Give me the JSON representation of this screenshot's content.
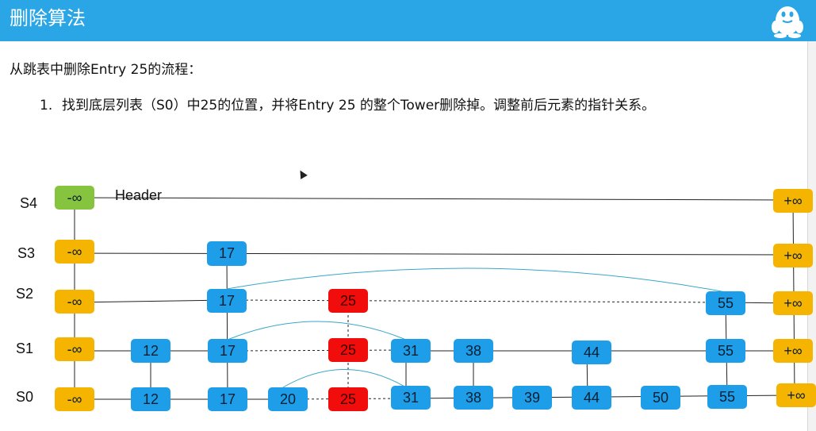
{
  "slide": {
    "title": "删除算法",
    "intro": "从跳表中删除Entry 25的流程：",
    "step_number": "1.",
    "step_text": "找到底层列表（S0）中25的位置，并将Entry 25 的整个Tower删除掉。调整前后元素的指针关系。"
  },
  "diagram": {
    "header_label": "Header",
    "levels": [
      "S4",
      "S3",
      "S2",
      "S1",
      "S0"
    ],
    "nodes": {
      "s4_neg": "-∞",
      "s4_pos": "+∞",
      "s3_neg": "-∞",
      "s3_17": "17",
      "s3_pos": "+∞",
      "s2_neg": "-∞",
      "s2_17": "17",
      "s2_25": "25",
      "s2_55": "55",
      "s2_pos": "+∞",
      "s1_neg": "-∞",
      "s1_12": "12",
      "s1_17": "17",
      "s1_25": "25",
      "s1_31": "31",
      "s1_38": "38",
      "s1_44": "44",
      "s1_55": "55",
      "s1_pos": "+∞",
      "s0_neg": "-∞",
      "s0_12": "12",
      "s0_17": "17",
      "s0_20": "20",
      "s0_25": "25",
      "s0_31": "31",
      "s0_38": "38",
      "s0_39": "39",
      "s0_44": "44",
      "s0_50": "50",
      "s0_55": "55",
      "s0_pos": "+∞"
    },
    "colors": {
      "header": "#86c440",
      "sentinel": "#f5b400",
      "node": "#1e9ee8",
      "deleted": "#f20d0d",
      "arc": "#3aa6c8"
    }
  }
}
